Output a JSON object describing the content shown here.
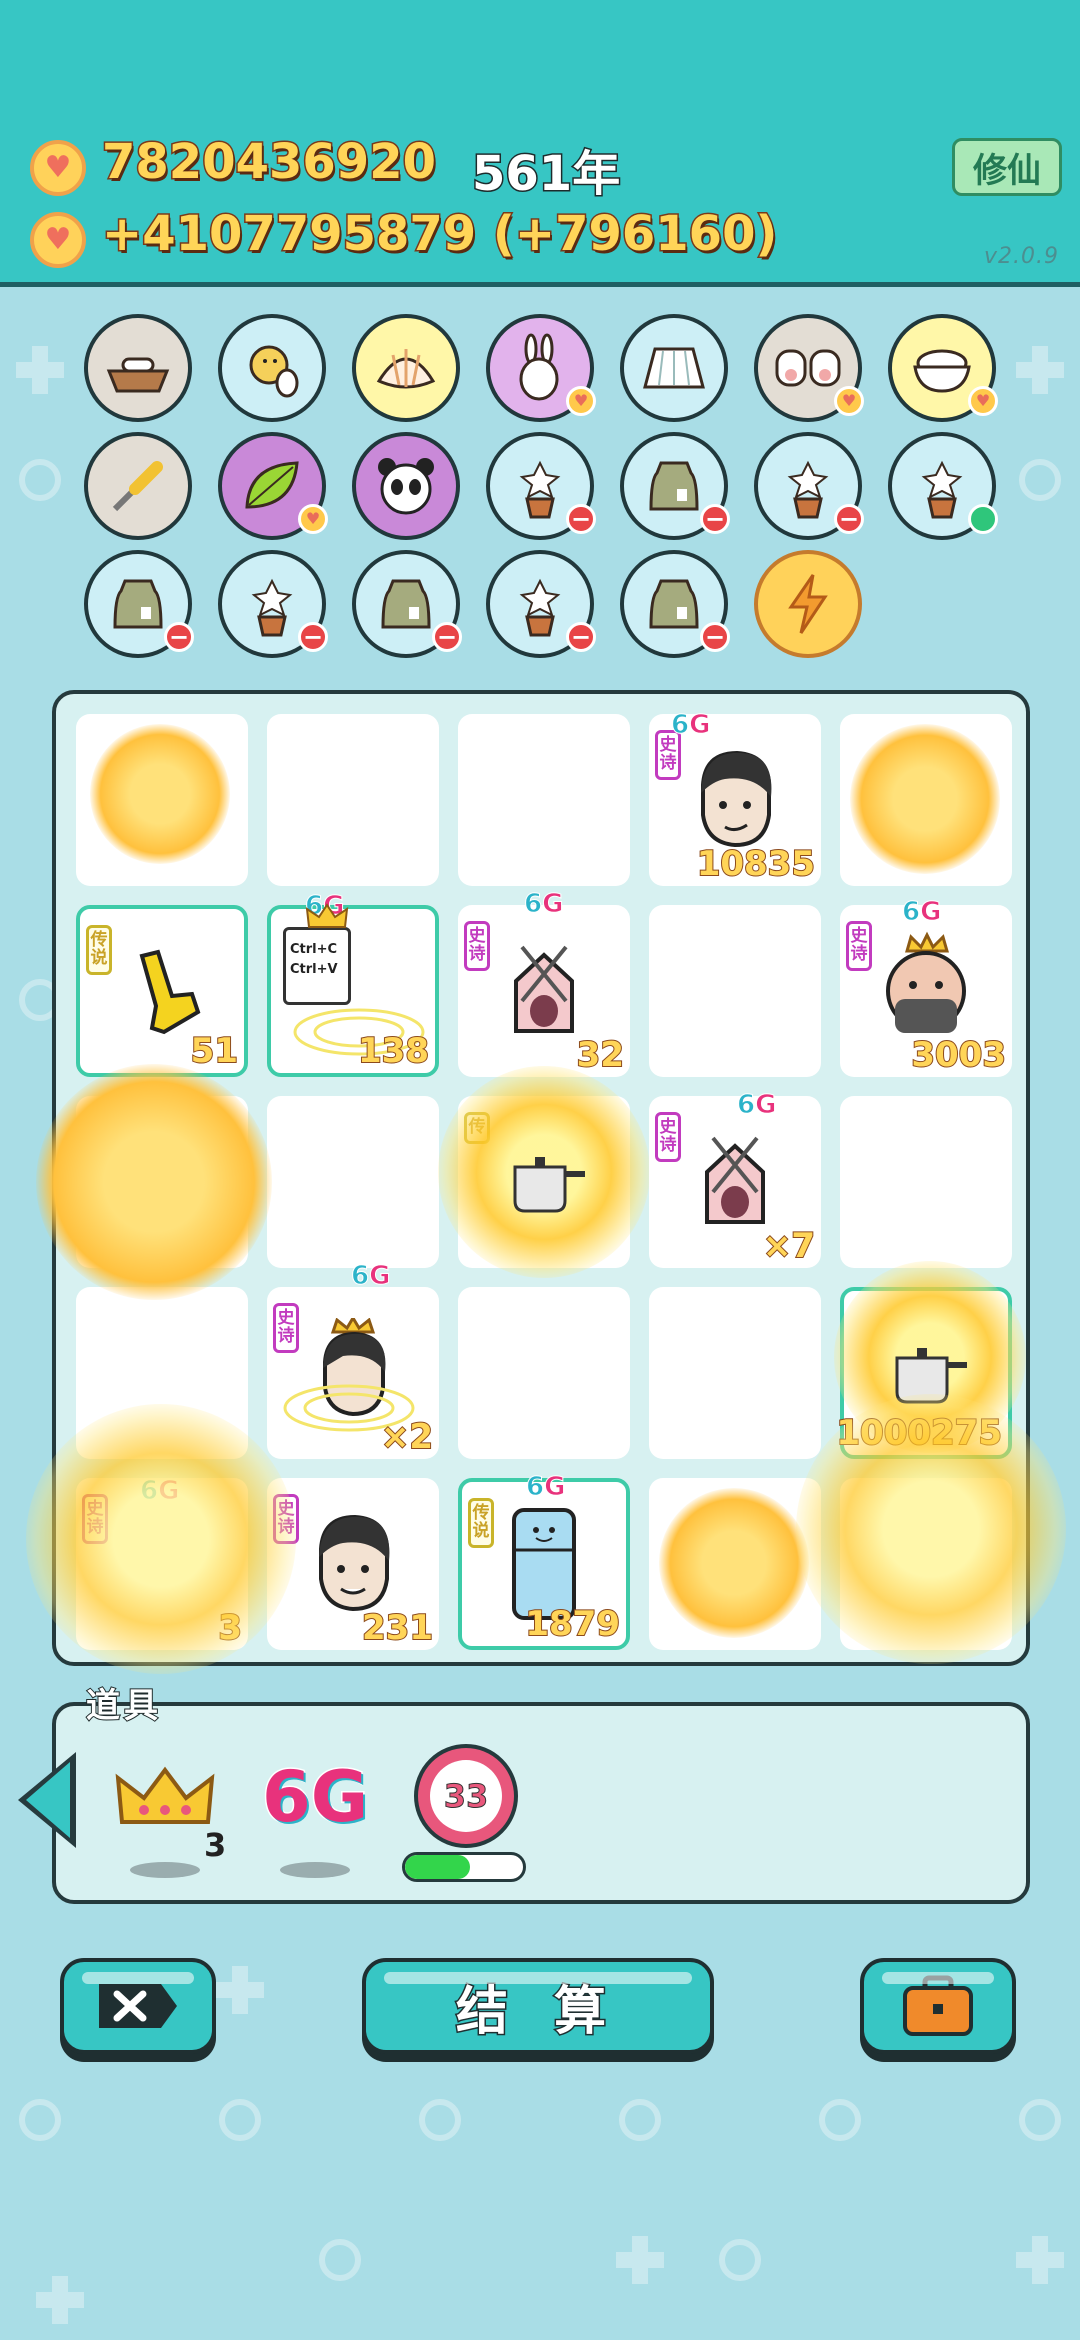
{
  "header": {
    "coins_total": "7820436920",
    "coins_rate": "+4107795879 (+796160)",
    "years": "561年",
    "mode_button": "修仙",
    "version": "v2.0.9"
  },
  "items_row_icons": [
    [
      "dog-bowl",
      "chick-egg",
      "seashell",
      "rabbit",
      "pleated-skirt",
      "two-cows",
      "rice-bowl"
    ],
    [
      "screwdriver",
      "leaf",
      "panda",
      "potted-flower",
      "garbage-bag",
      "potted-flower",
      "potted-flower"
    ],
    [
      "garbage-bag",
      "potted-flower",
      "garbage-bag",
      "potted-flower",
      "garbage-bag",
      "lightning"
    ]
  ],
  "board": {
    "cells": [
      {
        "number": "",
        "tag": "",
        "sixg": false
      },
      {
        "number": "",
        "tag": "",
        "sixg": false
      },
      {
        "number": "",
        "tag": "",
        "sixg": false
      },
      {
        "number": "10835",
        "tag": "史诗",
        "sixg": true
      },
      {
        "number": "",
        "tag": "",
        "sixg": false
      },
      {
        "number": "51",
        "tag": "传说",
        "sixg": false
      },
      {
        "number": "138",
        "tag": "",
        "sixg": true,
        "text": "Ctrl+C Ctrl+V"
      },
      {
        "number": "32",
        "tag": "史诗",
        "sixg": true
      },
      {
        "number": "",
        "tag": "",
        "sixg": false
      },
      {
        "number": "3003",
        "tag": "史诗",
        "sixg": true
      },
      {
        "number": "",
        "tag": "",
        "sixg": false
      },
      {
        "number": "",
        "tag": "",
        "sixg": false
      },
      {
        "number": "",
        "tag": "传",
        "sixg": false
      },
      {
        "number": "×7",
        "tag": "史诗",
        "sixg": true
      },
      {
        "number": "",
        "tag": "",
        "sixg": false
      },
      {
        "number": "",
        "tag": "",
        "sixg": false
      },
      {
        "number": "×2",
        "tag": "史诗",
        "sixg": true
      },
      {
        "number": "",
        "tag": "",
        "sixg": false
      },
      {
        "number": "",
        "tag": "",
        "sixg": false
      },
      {
        "number": "1000275",
        "tag": "",
        "sixg": false
      },
      {
        "number": "3",
        "tag": "史诗",
        "sixg": true
      },
      {
        "number": "231",
        "tag": "史诗",
        "sixg": false
      },
      {
        "number": "1879",
        "tag": "传说",
        "sixg": true
      },
      {
        "number": "",
        "tag": "",
        "sixg": false
      },
      {
        "number": "",
        "tag": "",
        "sixg": false
      }
    ]
  },
  "tools": {
    "label": "道具",
    "crown_count": "3",
    "sixg_label": "6G",
    "timer_value": "33",
    "timer_progress": 0.55
  },
  "buttons": {
    "settle_label": "结 算"
  },
  "colors": {
    "header_teal": "#37c6c4",
    "background": "#a9dde6",
    "coin_yellow": "#ffd558",
    "epic_purple": "#c23bbf",
    "legend_gold": "#c9b42a"
  }
}
